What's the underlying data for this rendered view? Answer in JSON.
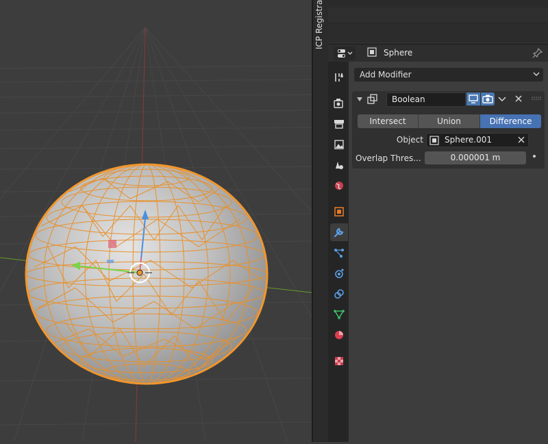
{
  "sidebar_tab": {
    "label": "ICP Registra"
  },
  "properties": {
    "object_name": "Sphere",
    "add_modifier_label": "Add Modifier",
    "modifier": {
      "name": "Boolean",
      "operations": [
        "Intersect",
        "Union",
        "Difference"
      ],
      "selected_operation": "Difference",
      "object_label": "Object",
      "object_value": "Sphere.001",
      "overlap_label": "Overlap Thres...",
      "overlap_value": "0.000001 m"
    }
  },
  "tabs": [
    "tool-icon",
    "render-icon",
    "output-icon",
    "view-layer-icon",
    "scene-icon",
    "world-icon",
    "object-icon",
    "modifier-icon",
    "particles-icon",
    "physics-icon",
    "constraints-icon",
    "data-icon",
    "material-icon",
    "texture-icon"
  ],
  "colors": {
    "accent": "#4772b3",
    "selection_orange": "#f0962d",
    "x_axis": "#8a3a3a",
    "y_axis": "#6a9a2a",
    "background": "#3d3d3d"
  }
}
